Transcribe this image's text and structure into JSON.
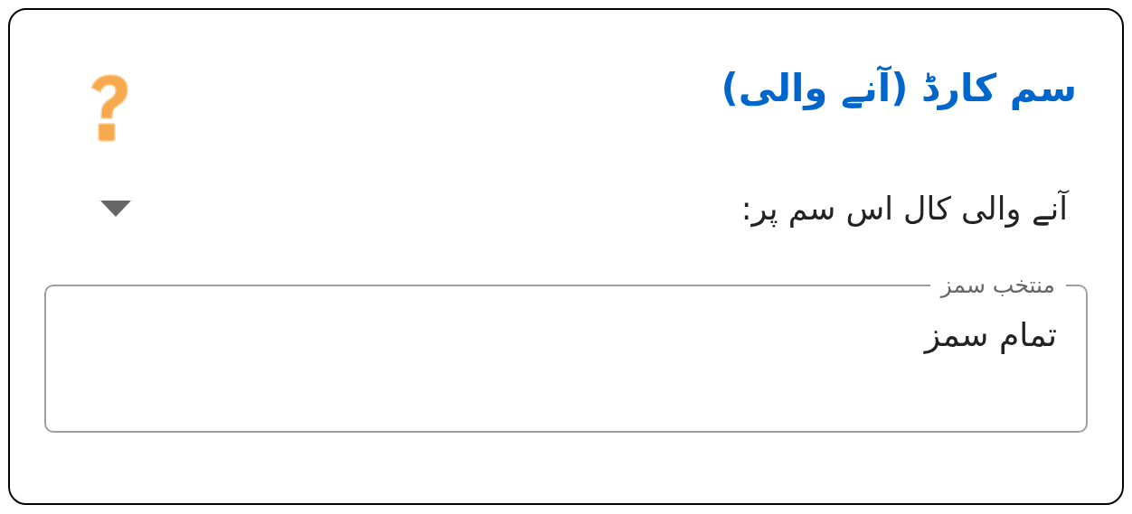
{
  "title": "سم کارڈ (آنے والی)",
  "incoming_call_dropdown": {
    "label": "آنے والی کال اس سم پر:"
  },
  "selected_sims": {
    "legend": "منتخب سمز",
    "value": "تمام سمز"
  }
}
